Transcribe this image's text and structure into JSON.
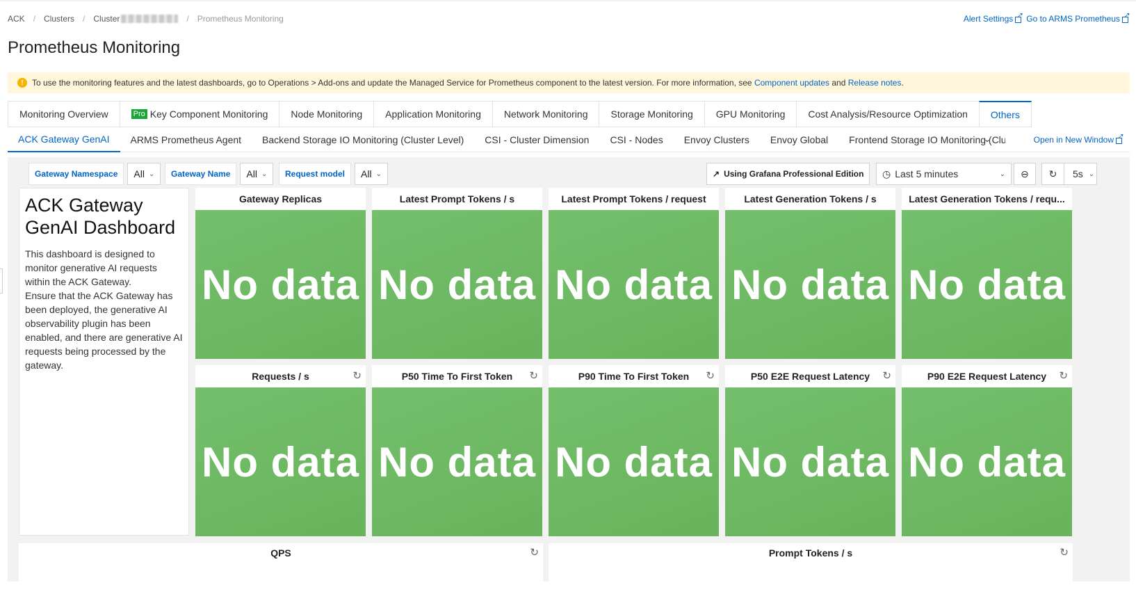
{
  "breadcrumb": {
    "item1": "ACK",
    "item2": "Clusters",
    "item3": "Cluster",
    "current": "Prometheus Monitoring"
  },
  "top_links": {
    "alert_settings": "Alert Settings",
    "go_to_arms": "Go to ARMS Prometheus"
  },
  "page_title": "Prometheus Monitoring",
  "notice": {
    "text_before": "To use the monitoring features and the latest dashboards, go to Operations > Add-ons and update the Managed Service for Prometheus component to the latest version. For more information, see ",
    "link1": "Component updates",
    "and": " and ",
    "link2": "Release notes",
    "end": "."
  },
  "tabs": {
    "monitoring_overview": "Monitoring Overview",
    "pro_badge": "Pro",
    "key_component": "Key Component Monitoring",
    "node": "Node Monitoring",
    "application": "Application Monitoring",
    "network": "Network Monitoring",
    "storage": "Storage Monitoring",
    "gpu": "GPU Monitoring",
    "cost": "Cost Analysis/Resource Optimization",
    "others": "Others"
  },
  "subtabs": {
    "gateway_genai": "ACK Gateway GenAI",
    "arms_agent": "ARMS Prometheus Agent",
    "backend_storage": "Backend Storage IO Monitoring (Cluster Level)",
    "csi_cluster": "CSI - Cluster Dimension",
    "csi_nodes": "CSI - Nodes",
    "envoy_clusters": "Envoy Clusters",
    "envoy_global": "Envoy Global",
    "frontend_storage": "Frontend Storage IO Monitoring (Cluster Level)",
    "open_new_window": "Open in New Window"
  },
  "variables": {
    "gateway_namespace": {
      "label": "Gateway Namespace",
      "value": "All"
    },
    "gateway_name": {
      "label": "Gateway Name",
      "value": "All"
    },
    "request_model": {
      "label": "Request model",
      "value": "All"
    }
  },
  "toolbar": {
    "grafana_pro": "Using Grafana Professional Edition",
    "time_range": "Last 5 minutes",
    "refresh_interval": "5s"
  },
  "intro": {
    "title": "ACK Gateway GenAI Dashboard",
    "para1": "This dashboard is designed to monitor generative AI requests within the ACK Gateway.",
    "para2": "Ensure that the ACK Gateway has been deployed, the generative AI observability plugin has been enabled, and there are generative AI requests being processed by the gateway."
  },
  "no_data_text": "No data",
  "panels_row1": [
    {
      "title": "Gateway Replicas"
    },
    {
      "title": "Latest Prompt Tokens / s"
    },
    {
      "title": "Latest Prompt Tokens / request"
    },
    {
      "title": "Latest Generation Tokens / s"
    },
    {
      "title": "Latest Generation Tokens / requ..."
    }
  ],
  "panels_row2": [
    {
      "title": "Requests / s"
    },
    {
      "title": "P50 Time To First Token"
    },
    {
      "title": "P90 Time To First Token"
    },
    {
      "title": "P50 E2E Request Latency"
    },
    {
      "title": "P90 E2E Request Latency"
    }
  ],
  "panels_row3": [
    {
      "title": "QPS"
    },
    {
      "title": "Prompt Tokens / s"
    }
  ],
  "colors": {
    "accent": "#0064c8",
    "stat_green": "#6cb863",
    "notice_bg": "#fff6dc"
  }
}
